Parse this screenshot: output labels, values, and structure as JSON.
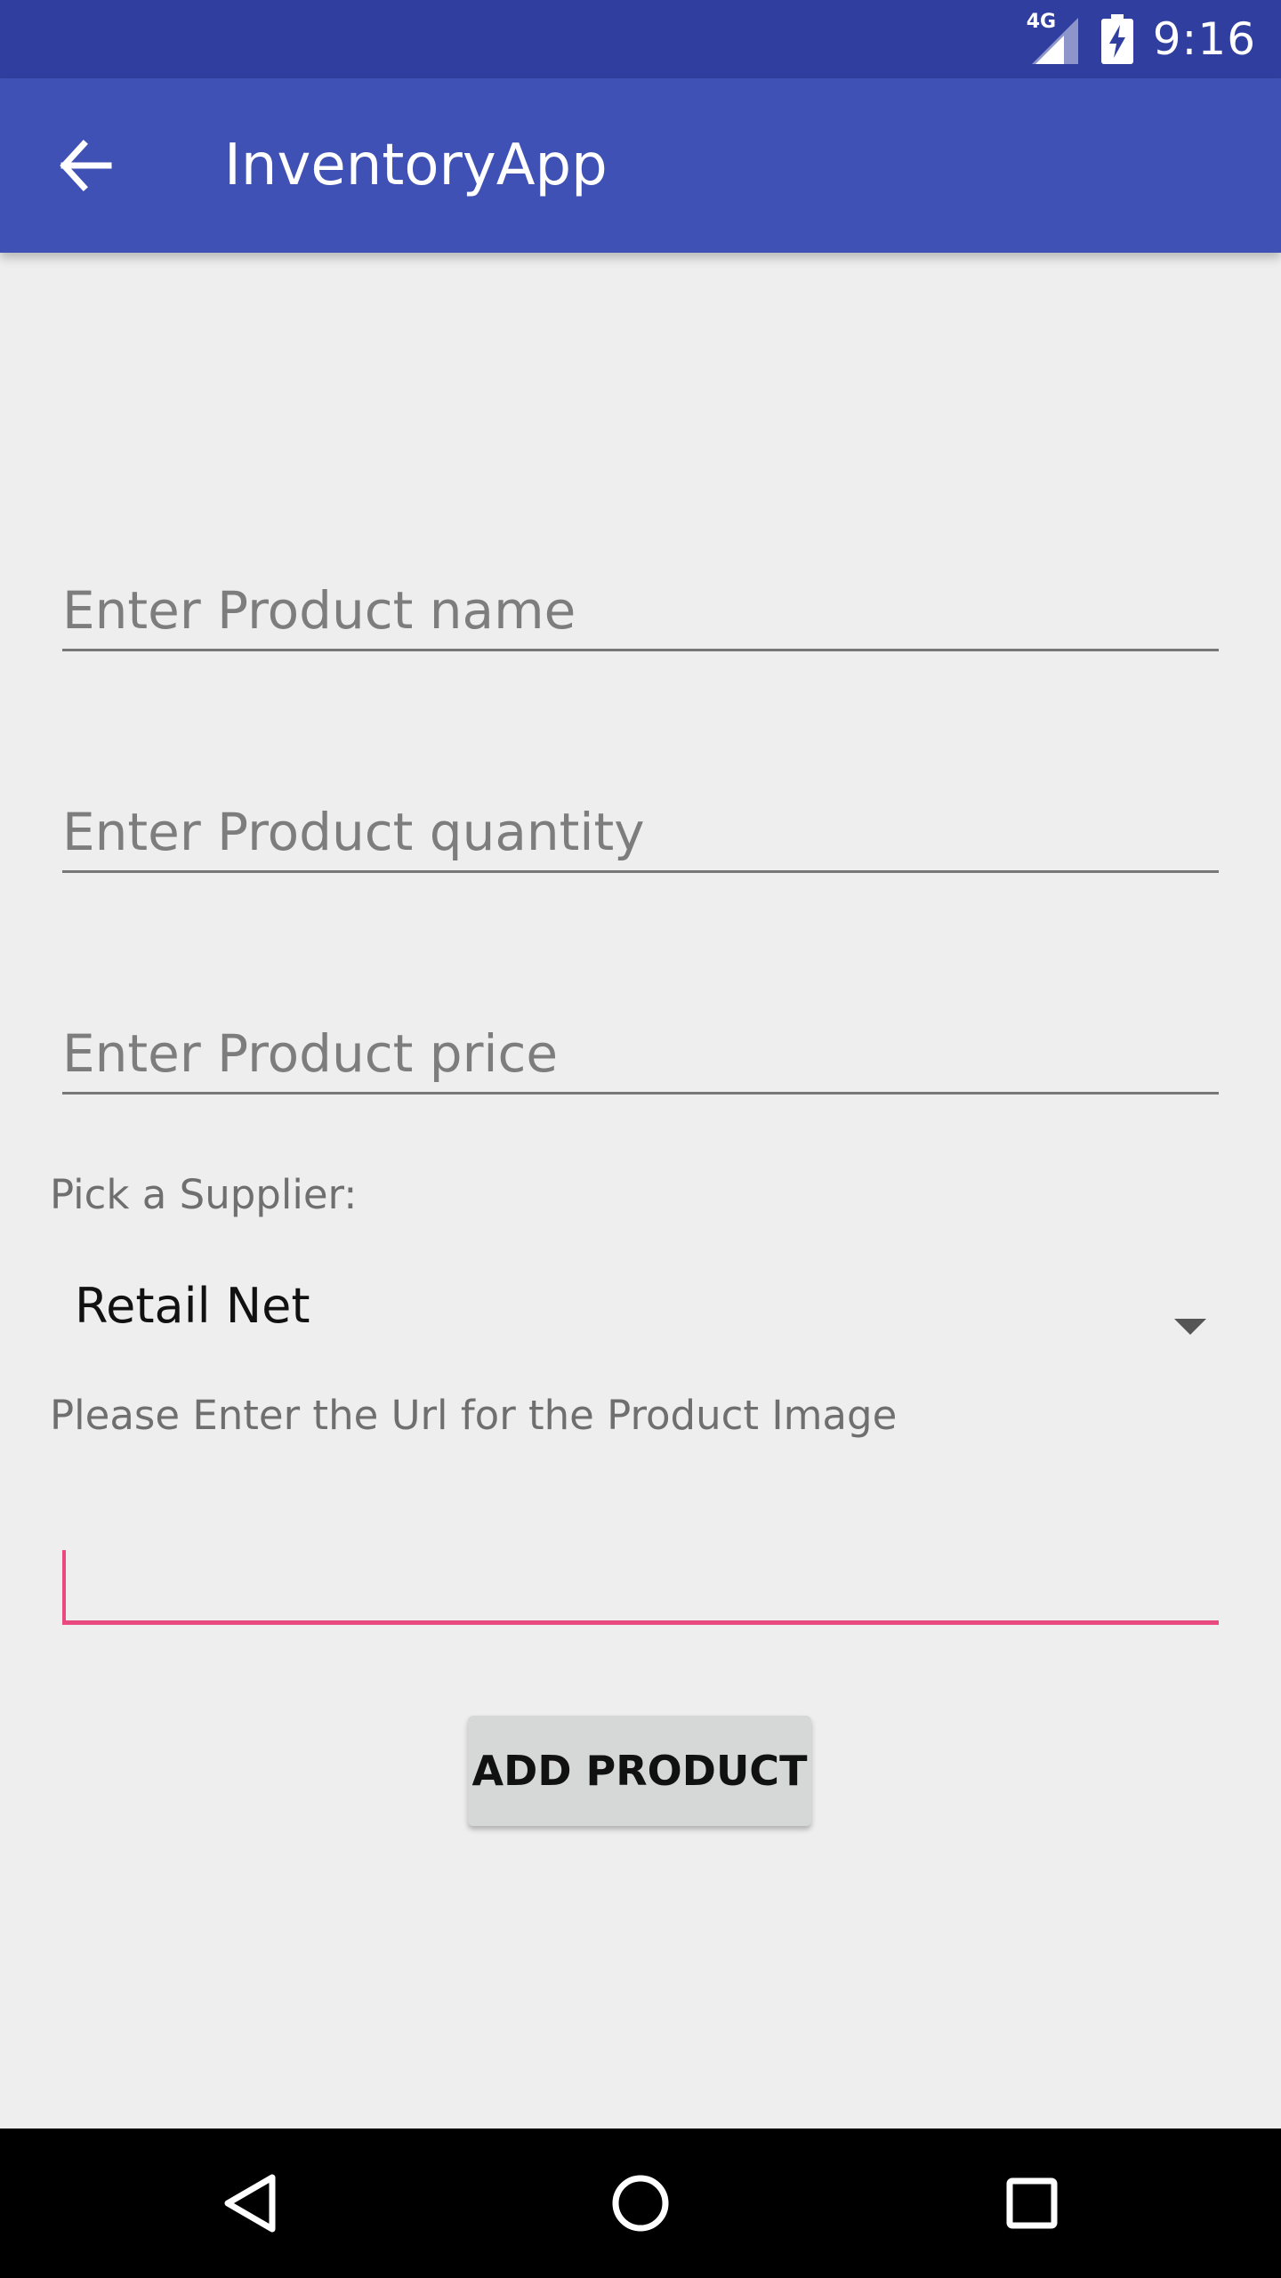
{
  "status_bar": {
    "time": "9:16",
    "network_label": "4G",
    "icons": [
      "signal-icon",
      "battery-charging-icon"
    ]
  },
  "app_bar": {
    "title": "InventoryApp",
    "back_icon": "arrow-back-icon",
    "color": "#3f51b5",
    "status_color": "#303f9f"
  },
  "form": {
    "product_name": {
      "value": "",
      "placeholder": "Enter Product name"
    },
    "product_quantity": {
      "value": "",
      "placeholder": "Enter Product quantity"
    },
    "product_price": {
      "value": "",
      "placeholder": "Enter Product price"
    },
    "supplier_label": "Pick a Supplier:",
    "supplier_selected": "Retail Net",
    "image_url_label": "Please Enter the Url for the Product Image",
    "image_url": {
      "value": "",
      "placeholder": ""
    },
    "accent_color": "#e84a7f",
    "submit_label": "ADD PRODUCT"
  },
  "nav_bar": {
    "icons": [
      "back-triangle-icon",
      "home-circle-icon",
      "recents-square-icon"
    ]
  }
}
